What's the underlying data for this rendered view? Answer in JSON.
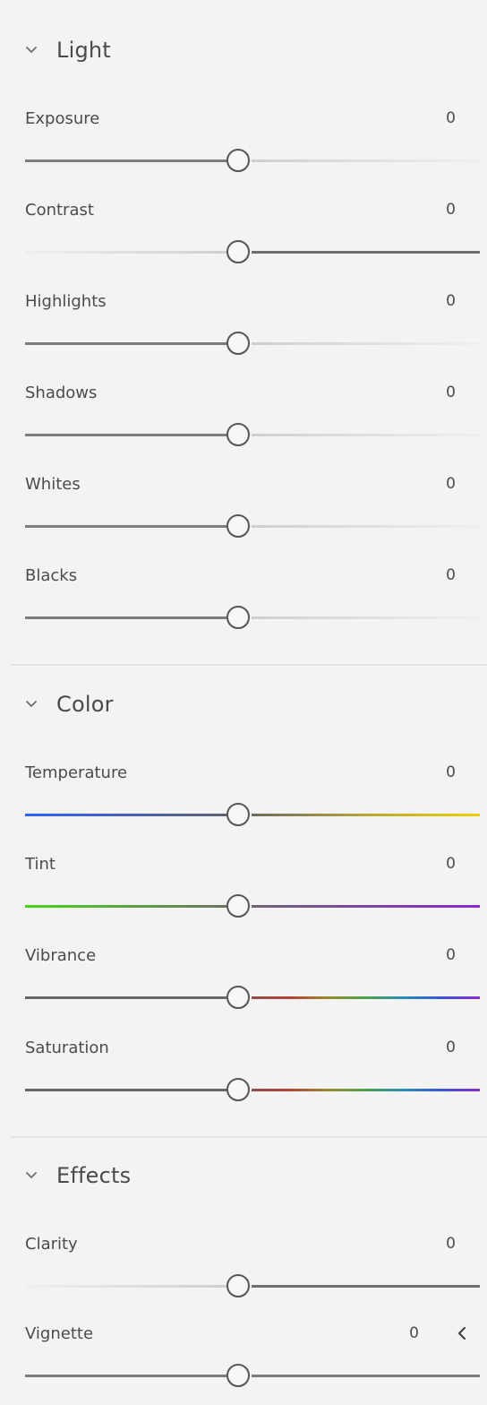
{
  "sections": [
    {
      "title": "Light",
      "sliders": [
        {
          "label": "Exposure",
          "value": "0"
        },
        {
          "label": "Contrast",
          "value": "0"
        },
        {
          "label": "Highlights",
          "value": "0"
        },
        {
          "label": "Shadows",
          "value": "0"
        },
        {
          "label": "Whites",
          "value": "0"
        },
        {
          "label": "Blacks",
          "value": "0"
        }
      ]
    },
    {
      "title": "Color",
      "sliders": [
        {
          "label": "Temperature",
          "value": "0"
        },
        {
          "label": "Tint",
          "value": "0"
        },
        {
          "label": "Vibrance",
          "value": "0"
        },
        {
          "label": "Saturation",
          "value": "0"
        }
      ]
    },
    {
      "title": "Effects",
      "sliders": [
        {
          "label": "Clarity",
          "value": "0"
        },
        {
          "label": "Vignette",
          "value": "0"
        }
      ]
    }
  ],
  "icons": {
    "section_toggle": "chevron-down-icon",
    "vignette_expand": "chevron-left-icon"
  },
  "colors": {
    "background": "#f3f3f3",
    "text": "#4b4b4b",
    "track_dark": "#7a7a7a",
    "track_light": "#e2e2e2",
    "temperature_blue": "#2f63ff",
    "temperature_yellow": "#f0d000",
    "tint_green": "#45d61b",
    "tint_purple": "#8b28d0"
  },
  "slider_positions": {
    "exposure": 0.5,
    "contrast": 0.5,
    "highlights": 0.5,
    "shadows": 0.5,
    "whites": 0.5,
    "blacks": 0.5,
    "temperature": 0.5,
    "tint": 0.5,
    "vibrance": 0.5,
    "saturation": 0.5,
    "clarity": 0.5,
    "vignette": 0.5
  }
}
